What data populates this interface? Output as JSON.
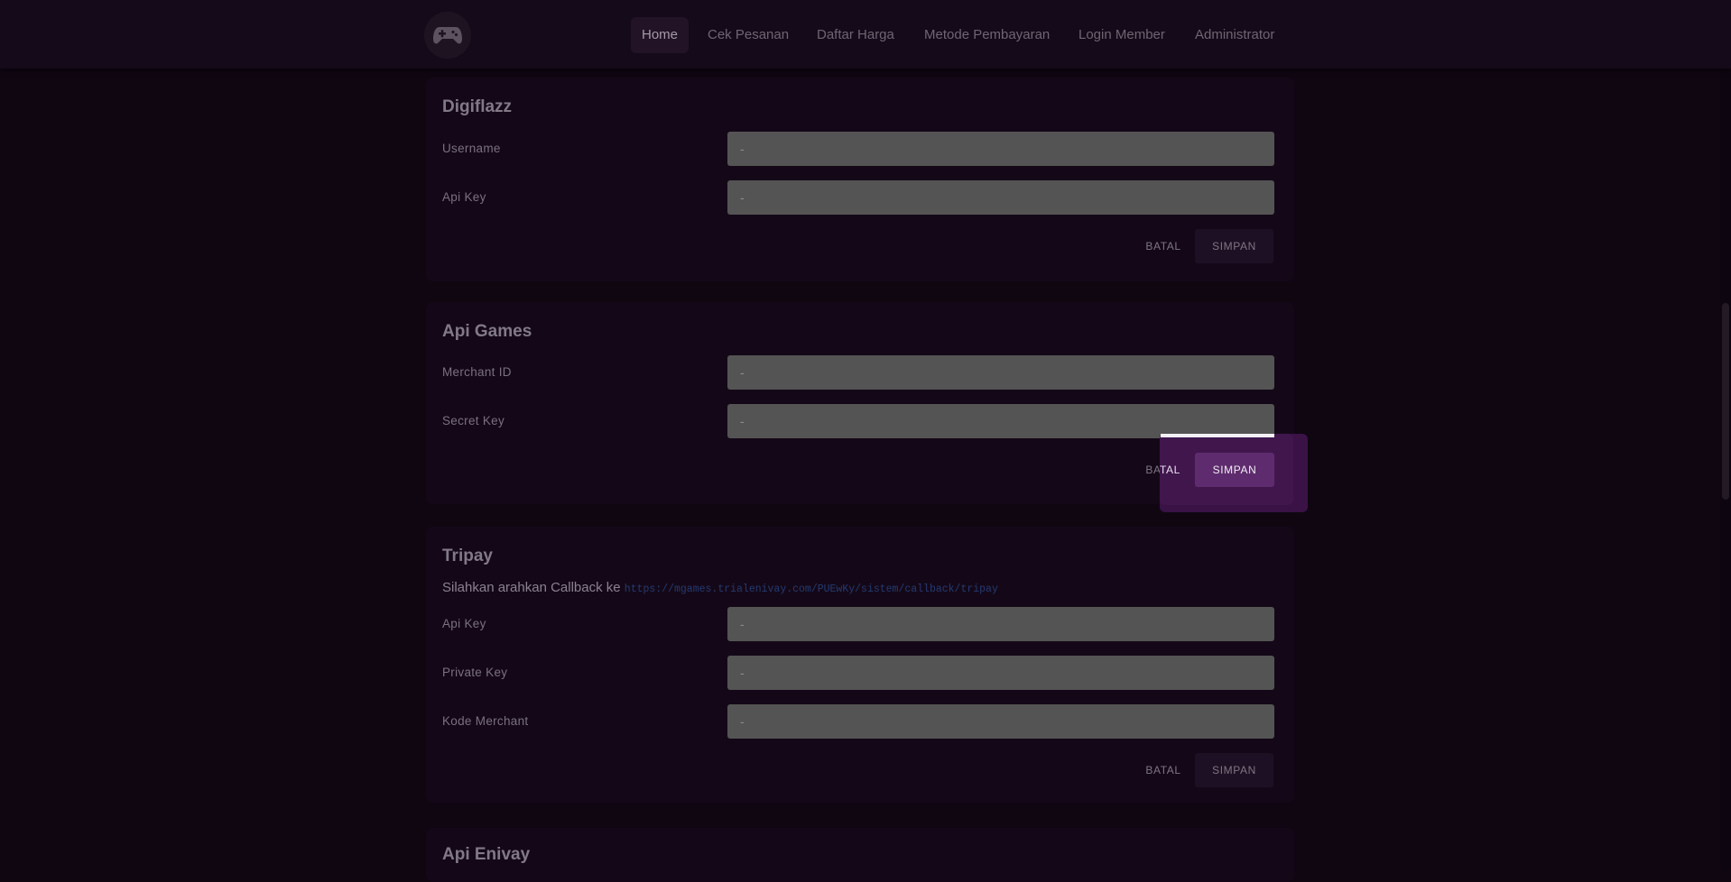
{
  "nav": {
    "items": [
      "Home",
      "Cek Pesanan",
      "Daftar Harga",
      "Metode Pembayaran",
      "Login Member",
      "Administrator"
    ],
    "active": "Home",
    "logo_icon": "gamepad-icon"
  },
  "digiflazz": {
    "title": "Digiflazz",
    "fields": [
      {
        "label": "Username",
        "value": "-"
      },
      {
        "label": "Api Key",
        "value": "-"
      }
    ],
    "cancel_label": "BATAL",
    "save_label": "SIMPAN"
  },
  "apigames": {
    "title": "Api Games",
    "fields": [
      {
        "label": "Merchant ID",
        "value": "-"
      },
      {
        "label": "Secret Key",
        "value": "-"
      }
    ],
    "cancel_label": "BATAL",
    "save_label": "SIMPAN",
    "cancel_label_highlight_part": "TAL"
  },
  "tripay": {
    "title": "Tripay",
    "callback_text": "Silahkan arahkan Callback ke",
    "callback_url": "https://mgames.trialenivay.com/PUEwKy/sistem/callback/tripay",
    "fields": [
      {
        "label": "Api Key",
        "value": "-"
      },
      {
        "label": "Private Key",
        "value": "-"
      },
      {
        "label": "Kode Merchant",
        "value": "-"
      }
    ],
    "cancel_label": "BATAL",
    "save_label": "SIMPAN"
  },
  "apienivay": {
    "title": "Api Enivay"
  },
  "colors": {
    "background": "#0f0612",
    "card": "#140818",
    "highlight": "#5e2c6e"
  }
}
